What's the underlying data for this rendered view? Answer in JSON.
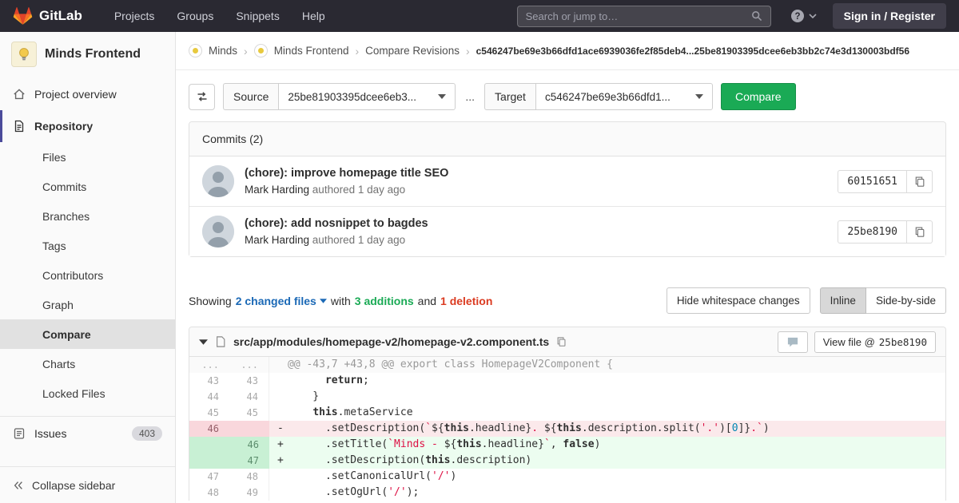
{
  "navbar": {
    "brand": "GitLab",
    "menu": [
      "Projects",
      "Groups",
      "Snippets",
      "Help"
    ],
    "search_placeholder": "Search or jump to…",
    "signin_label": "Sign in / Register"
  },
  "sidebar": {
    "project_name": "Minds Frontend",
    "overview_label": "Project overview",
    "repository_label": "Repository",
    "repo_subitems": [
      {
        "label": "Files"
      },
      {
        "label": "Commits"
      },
      {
        "label": "Branches"
      },
      {
        "label": "Tags"
      },
      {
        "label": "Contributors"
      },
      {
        "label": "Graph"
      },
      {
        "label": "Compare",
        "active": true
      },
      {
        "label": "Charts"
      },
      {
        "label": "Locked Files"
      }
    ],
    "issues_label": "Issues",
    "issues_count": "403",
    "collapse_label": "Collapse sidebar"
  },
  "breadcrumb": {
    "items": [
      "Minds",
      "Minds Frontend",
      "Compare Revisions"
    ],
    "current": "c546247be69e3b66dfd1ace6939036fe2f85deb4...25be81903395dcee6eb3bb2c74e3d130003bdf56"
  },
  "compare_form": {
    "source_label": "Source",
    "source_value": "25be81903395dcee6eb3...",
    "separator": "...",
    "target_label": "Target",
    "target_value": "c546247be69e3b66dfd1...",
    "compare_button": "Compare"
  },
  "commits_panel": {
    "header": "Commits (2)",
    "commits": [
      {
        "title": "(chore): improve homepage title SEO",
        "author": "Mark Harding",
        "meta": "authored 1 day ago",
        "sha": "60151651"
      },
      {
        "title": "(chore): add nosnippet to bagdes",
        "author": "Mark Harding",
        "meta": "authored 1 day ago",
        "sha": "25be8190"
      }
    ]
  },
  "changes_bar": {
    "showing": "Showing",
    "files_link": "2 changed files",
    "with": "with",
    "additions": "3 additions",
    "and": "and",
    "deletions": "1 deletion",
    "whitespace_button": "Hide whitespace changes",
    "inline_button": "Inline",
    "side_by_side_button": "Side-by-side"
  },
  "diff": {
    "file_path": "src/app/modules/homepage-v2/homepage-v2.component.ts",
    "view_file_label": "View file @",
    "view_file_sha": "25be8190",
    "lines": [
      {
        "old": "...",
        "new": "...",
        "type": "match",
        "text": "@@ -43,7 +43,8 @@ export class HomepageV2Component {"
      },
      {
        "old": "43",
        "new": "43",
        "type": "ctx",
        "marker": "",
        "segments": [
          [
            "p",
            "      "
          ],
          [
            "k",
            "return"
          ],
          [
            "p",
            ";"
          ]
        ]
      },
      {
        "old": "44",
        "new": "44",
        "type": "ctx",
        "marker": "",
        "segments": [
          [
            "p",
            "    }"
          ]
        ]
      },
      {
        "old": "45",
        "new": "45",
        "type": "ctx",
        "marker": "",
        "segments": [
          [
            "p",
            "    "
          ],
          [
            "k",
            "this"
          ],
          [
            "p",
            ".metaService"
          ]
        ]
      },
      {
        "old": "46",
        "new": "",
        "type": "del",
        "marker": "-",
        "segments": [
          [
            "p",
            "      .setDescription("
          ],
          [
            "s",
            "`"
          ],
          [
            "p",
            "${"
          ],
          [
            "k",
            "this"
          ],
          [
            "p",
            ".headline}"
          ],
          [
            "s",
            ". "
          ],
          [
            "p",
            "${"
          ],
          [
            "k",
            "this"
          ],
          [
            "p",
            ".description.split("
          ],
          [
            "s",
            "'.'"
          ],
          [
            "p",
            ")["
          ],
          [
            "n",
            "0"
          ],
          [
            "p",
            "]}"
          ],
          [
            "s",
            ".`"
          ],
          [
            "p",
            ")"
          ]
        ]
      },
      {
        "old": "",
        "new": "46",
        "type": "add",
        "marker": "+",
        "segments": [
          [
            "p",
            "      .setTitle("
          ],
          [
            "s",
            "`Minds - "
          ],
          [
            "p",
            "${"
          ],
          [
            "k",
            "this"
          ],
          [
            "p",
            ".headline}"
          ],
          [
            "s",
            "`"
          ],
          [
            "p",
            ", "
          ],
          [
            "k",
            "false"
          ],
          [
            "p",
            ")"
          ]
        ]
      },
      {
        "old": "",
        "new": "47",
        "type": "add",
        "marker": "+",
        "segments": [
          [
            "p",
            "      .setDescription("
          ],
          [
            "k",
            "this"
          ],
          [
            "p",
            ".description)"
          ]
        ]
      },
      {
        "old": "47",
        "new": "48",
        "type": "ctx",
        "marker": "",
        "segments": [
          [
            "p",
            "      .setCanonicalUrl("
          ],
          [
            "s",
            "'/'"
          ],
          [
            "p",
            ")"
          ]
        ]
      },
      {
        "old": "48",
        "new": "49",
        "type": "ctx",
        "marker": "",
        "segments": [
          [
            "p",
            "      .setOgUrl("
          ],
          [
            "s",
            "'/'"
          ],
          [
            "p",
            ");"
          ]
        ]
      }
    ]
  },
  "colors": {
    "navbar_bg": "#2a2932",
    "accent_green": "#1aaa55",
    "deletion_red": "#db3b21",
    "link_blue": "#1b69b6",
    "sidebar_active_border": "#4b4b9b"
  }
}
